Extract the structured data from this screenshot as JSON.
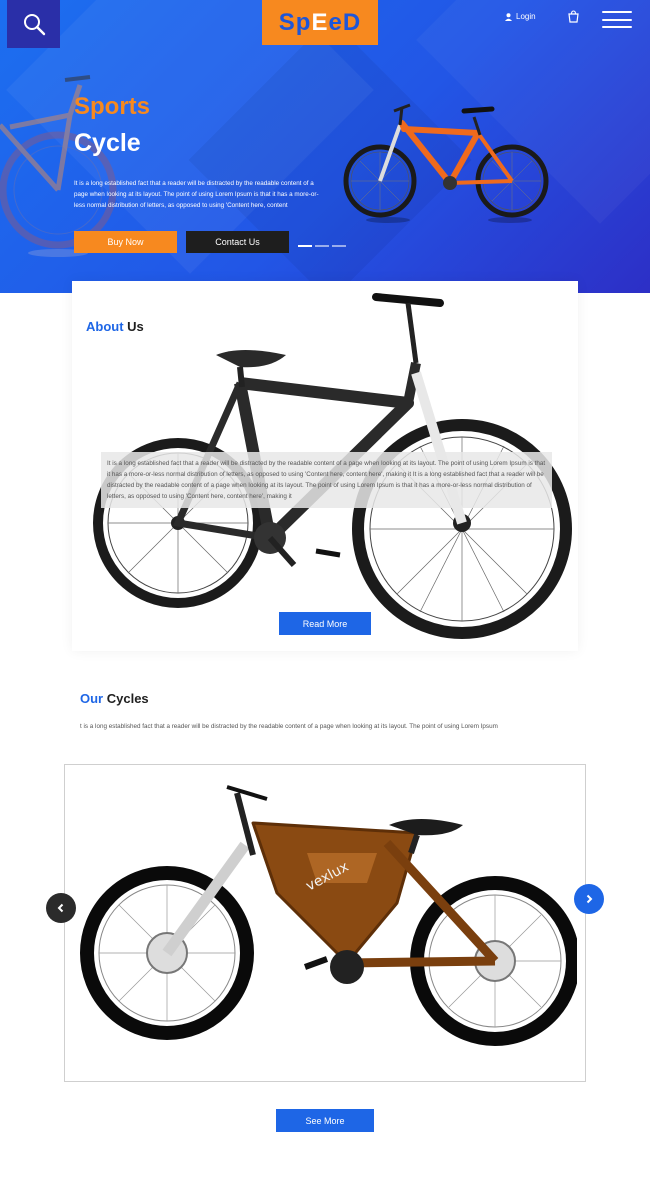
{
  "header": {
    "logo": {
      "part1": "Sp",
      "part2": "E",
      "part3": "e",
      "part4": "D"
    },
    "login_label": "Login",
    "icons": {
      "search": "search-icon",
      "user": "user-icon",
      "cart": "cart-icon",
      "menu": "hamburger-menu-icon"
    }
  },
  "hero": {
    "title_line1": "Sports",
    "title_line2": "Cycle",
    "text": "It is a long established fact that a reader will be distracted by the readable content of a page when looking at its layout. The point of using Lorem Ipsum is that it has a more-or-less normal distribution of letters, as opposed to using 'Content here, content",
    "buy_label": "Buy Now",
    "contact_label": "Contact Us",
    "slide_count": 3,
    "active_slide": 1
  },
  "about": {
    "title_accent": "About",
    "title_rest": " Us",
    "text": "It is a long established fact that a reader will be distracted by the readable content of a page when looking at its layout. The point of using Lorem Ipsum is that it has a more-or-less normal distribution of letters, as opposed to using 'Content here, content here', making it It is a long established fact that a reader will be distracted by the readable content of a page when looking at its layout. The point of using Lorem Ipsum is that it has a more-or-less normal distribution of letters, as opposed to using 'Content here, content here', making it",
    "read_more_label": "Read More"
  },
  "cycles": {
    "title_accent": "Our",
    "title_rest": " Cycles",
    "text": "t is a long established fact that a reader will be distracted by the readable content of a page when looking at its layout. The point of using Lorem Ipsum",
    "see_more_label": "See More",
    "bike_brand_text": "vexlux",
    "icons": {
      "prev": "chevron-left-icon",
      "next": "chevron-right-icon"
    }
  },
  "colors": {
    "primary_blue": "#1e66e6",
    "accent_orange": "#f7891f",
    "dark": "#1e1e1e",
    "hero_gradient_end": "#2d2fc6"
  }
}
